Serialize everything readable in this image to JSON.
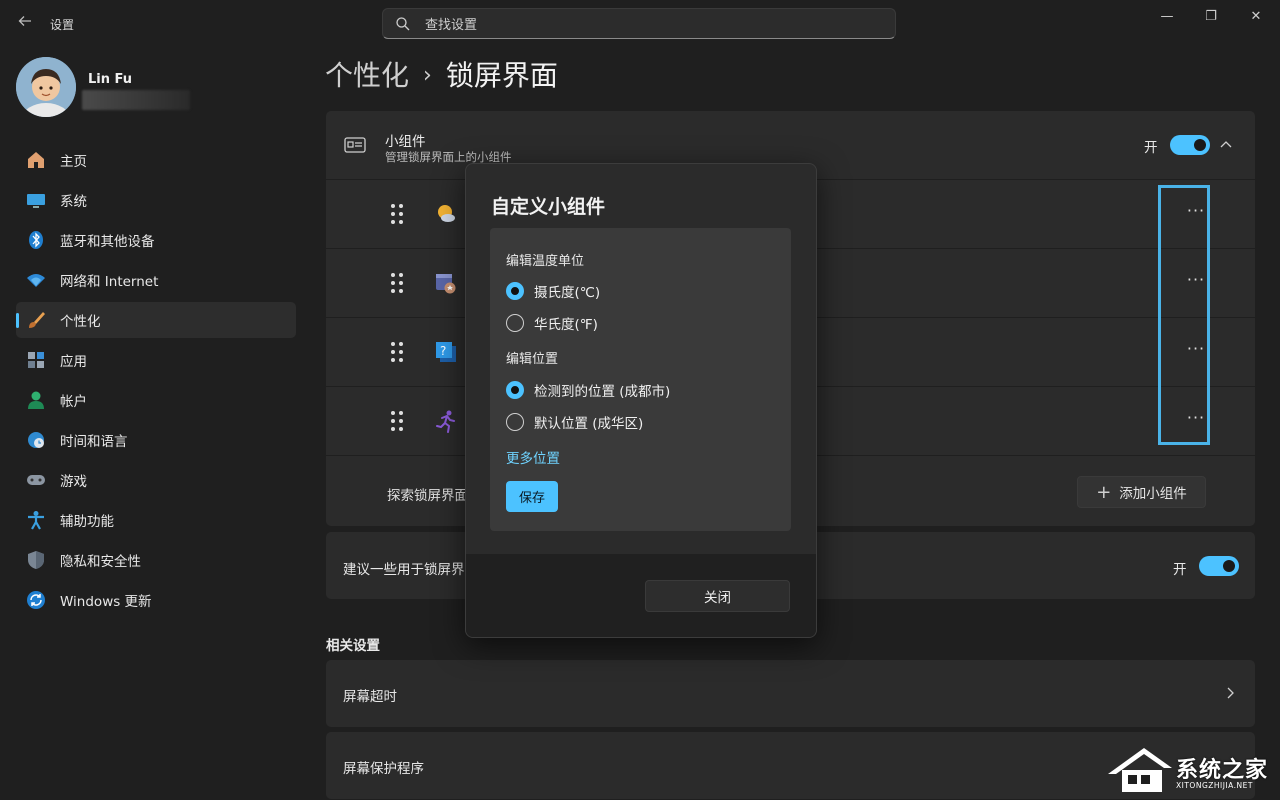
{
  "app": {
    "title": "设置",
    "back_icon": "back-arrow-icon"
  },
  "search": {
    "placeholder": "查找设置"
  },
  "window_controls": {
    "minimize": "—",
    "restore": "❐",
    "close": "✕"
  },
  "user": {
    "name": "Lin Fu"
  },
  "sidebar": {
    "items": [
      {
        "label": "主页",
        "icon": "home-icon"
      },
      {
        "label": "系统",
        "icon": "monitor-icon"
      },
      {
        "label": "蓝牙和其他设备",
        "icon": "bluetooth-icon"
      },
      {
        "label": "网络和 Internet",
        "icon": "wifi-icon"
      },
      {
        "label": "个性化",
        "icon": "brush-icon",
        "active": true
      },
      {
        "label": "应用",
        "icon": "apps-icon"
      },
      {
        "label": "帐户",
        "icon": "account-icon"
      },
      {
        "label": "时间和语言",
        "icon": "globe-clock-icon"
      },
      {
        "label": "游戏",
        "icon": "gamepad-icon"
      },
      {
        "label": "辅助功能",
        "icon": "accessibility-icon"
      },
      {
        "label": "隐私和安全性",
        "icon": "shield-icon"
      },
      {
        "label": "Windows 更新",
        "icon": "update-icon"
      }
    ]
  },
  "breadcrumb": {
    "parent": "个性化",
    "separator": "›",
    "current": "锁屏界面"
  },
  "widgets": {
    "title": "小组件",
    "subtitle": "管理锁屏界面上的小组件",
    "toggle_label": "开",
    "rows": [
      {
        "icon": "weather-icon"
      },
      {
        "icon": "calendar-icon"
      },
      {
        "icon": "tips-icon"
      },
      {
        "icon": "fitness-icon"
      }
    ],
    "more_label": "···",
    "explore_text": "探索锁屏界面",
    "add_button": "添加小组件",
    "add_icon": "+"
  },
  "suggest": {
    "text": "建议一些用于锁屏界",
    "toggle_label": "开"
  },
  "related": {
    "heading": "相关设置",
    "items": [
      {
        "label": "屏幕超时"
      },
      {
        "label": "屏幕保护程序"
      }
    ],
    "chevron": "›"
  },
  "dialog": {
    "title": "自定义小组件",
    "temp_heading": "编辑温度单位",
    "temp_options": [
      {
        "label": "摄氏度(℃)",
        "checked": true
      },
      {
        "label": "华氏度(℉)",
        "checked": false
      }
    ],
    "location_heading": "编辑位置",
    "location_options": [
      {
        "label": "检测到的位置 (成都市)",
        "checked": true
      },
      {
        "label": "默认位置 (成华区)",
        "checked": false
      }
    ],
    "more_locations": "更多位置",
    "save": "保存",
    "close": "关闭"
  },
  "watermark": {
    "name": "系统之家",
    "url": "XITONGZHIJIA.NET"
  },
  "colors": {
    "accent": "#4cc2ff",
    "highlight": "#4ab3e8",
    "background": "#1f1f1f",
    "card": "#2b2b2b"
  }
}
